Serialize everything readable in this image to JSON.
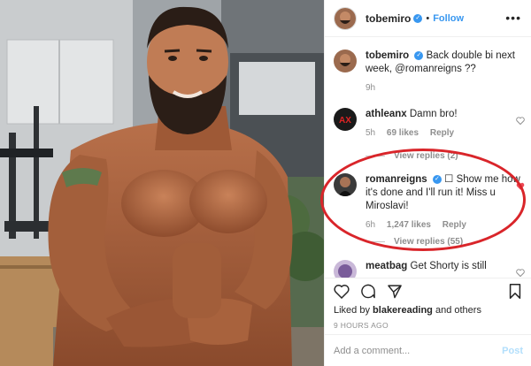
{
  "header": {
    "username": "tobemiro",
    "separator": "•",
    "follow_label": "Follow",
    "more_label": "•••"
  },
  "caption": {
    "username": "tobemiro",
    "text": "Back double bi next week, @romanreigns ??",
    "age": "9h"
  },
  "comments": [
    {
      "username": "athleanx",
      "text": "Damn bro!",
      "age": "5h",
      "likes": "69 likes",
      "reply_label": "Reply",
      "view_replies": "View replies (2)",
      "liked": false,
      "avatar_text": "AX"
    },
    {
      "username": "romanreigns",
      "text": "☐ Show me how it's done and I'll run it! Miss u Miroslavi!",
      "age": "6h",
      "likes": "1,247 likes",
      "reply_label": "Reply",
      "view_replies": "View replies (55)",
      "liked": true
    },
    {
      "username": "meatbag",
      "text": "Get Shorty is still",
      "liked": false
    }
  ],
  "actions": {
    "liked_by_prefix": "Liked by",
    "liked_by_user": "blakereading",
    "liked_by_suffix": "and others",
    "time_ago": "9 HOURS AGO"
  },
  "add_comment": {
    "placeholder": "Add a comment...",
    "post_label": "Post"
  },
  "colors": {
    "link": "#3897f0",
    "heart_red": "#ed4956",
    "highlight_ring": "#d9252a",
    "muted": "#8e8e8e"
  }
}
